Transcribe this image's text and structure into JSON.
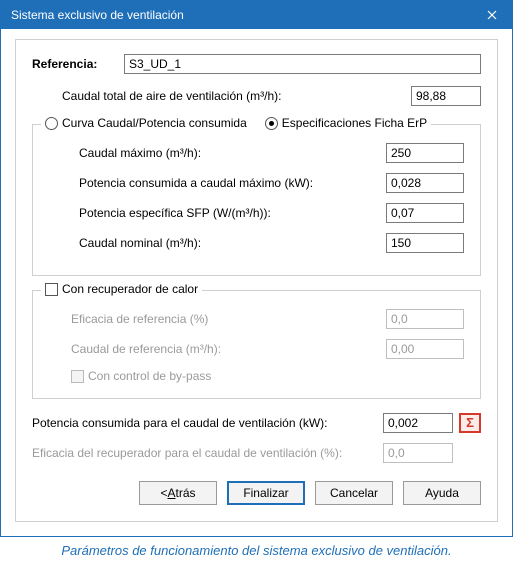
{
  "window": {
    "title": "Sistema exclusivo de ventilación"
  },
  "reference": {
    "label": "Referencia:",
    "value": "S3_UD_1"
  },
  "total_airflow": {
    "label": "Caudal total de aire de ventilación (m³/h):",
    "value": "98,88"
  },
  "spec_mode": {
    "curve_label": "Curva Caudal/Potencia consumida",
    "erp_label": "Especificaciones Ficha ErP",
    "selected": "erp"
  },
  "specs": {
    "max_flow_label": "Caudal máximo (m³/h):",
    "max_flow_value": "250",
    "max_power_label": "Potencia consumida a caudal máximo (kW):",
    "max_power_value": "0,028",
    "sfp_label": "Potencia específica SFP (W/(m³/h)):",
    "sfp_value": "0,07",
    "nominal_flow_label": "Caudal nominal (m³/h):",
    "nominal_flow_value": "150"
  },
  "recovery": {
    "checkbox_label": "Con recuperador de calor",
    "eff_label": "Eficacia de referencia (%)",
    "eff_value": "0,0",
    "flow_label": "Caudal de referencia (m³/h):",
    "flow_value": "0,00",
    "bypass_label": "Con control de by-pass"
  },
  "results": {
    "power_label": "Potencia consumida para el caudal de ventilación (kW):",
    "power_value": "0,002",
    "rec_eff_label": "Eficacia del recuperador para el caudal de ventilación (%):",
    "rec_eff_value": "0,0"
  },
  "buttons": {
    "back": "Atrás",
    "finish": "Finalizar",
    "cancel": "Cancelar",
    "help": "Ayuda"
  },
  "caption": "Parámetros de funcionamiento del sistema exclusivo de ventilación."
}
